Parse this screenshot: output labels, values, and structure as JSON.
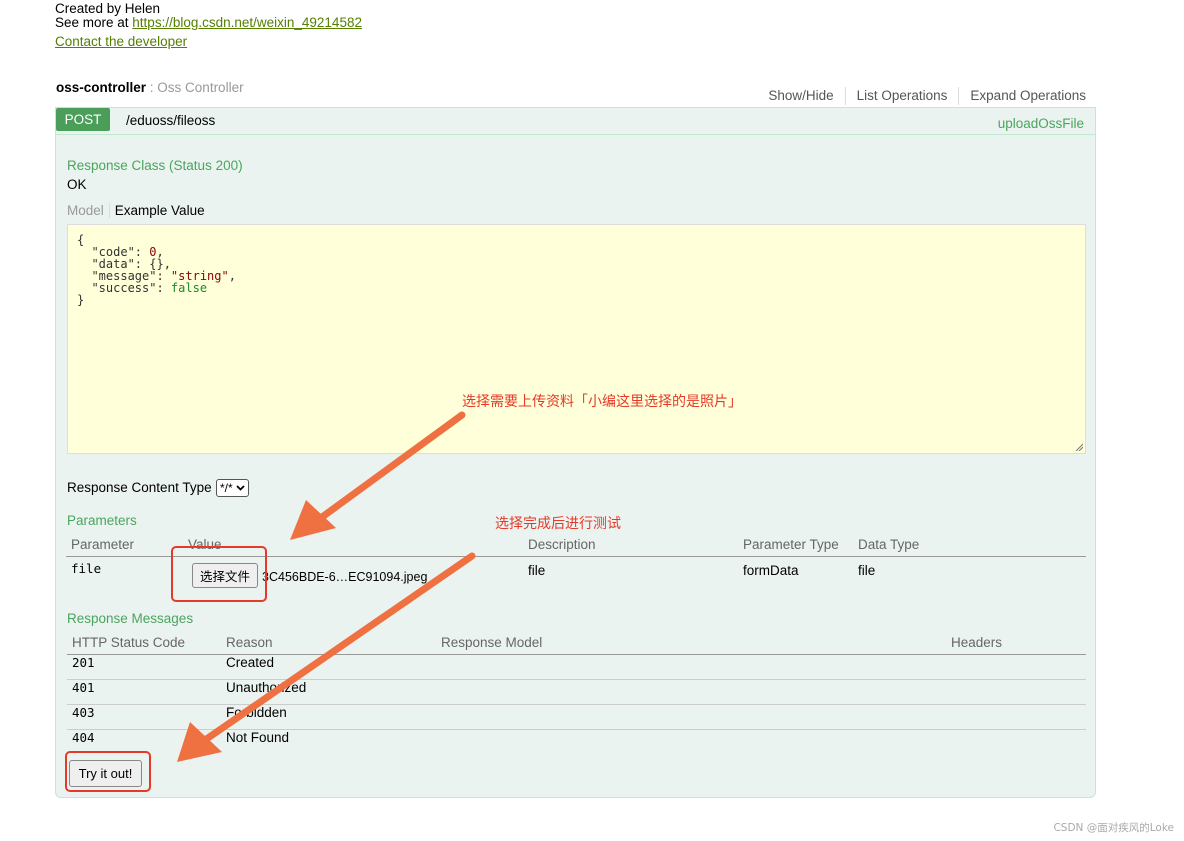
{
  "header": {
    "created_by": "Created by Helen",
    "see_more_prefix": "See more at ",
    "see_more_link": "https://blog.csdn.net/weixin_49214582",
    "contact": "Contact the developer"
  },
  "controller": {
    "name": "oss-controller",
    "separator": " : ",
    "description": "Oss Controller",
    "links": [
      "Show/Hide",
      "List Operations",
      "Expand Operations"
    ]
  },
  "operation": {
    "method": "POST",
    "path": "/eduoss/fileoss",
    "nickname": "uploadOssFile",
    "method_color": "#4a9e5a",
    "response_class_title": "Response Class (Status 200)",
    "response_class_value": "OK",
    "model_tab": "Model",
    "example_tab": "Example Value",
    "example_json": {
      "open": "{",
      "code_key": "  \"code\": ",
      "code_val": "0",
      "data_key": "  \"data\": ",
      "data_val": "{}",
      "message_key": "  \"message\": ",
      "message_val": "\"string\"",
      "success_key": "  \"success\": ",
      "success_val": "false",
      "close": "}"
    },
    "response_content_type_label": "Response Content Type",
    "response_content_type_value": "*/*",
    "parameters_title": "Parameters",
    "parameters_headers": [
      "Parameter",
      "Value",
      "Description",
      "Parameter Type",
      "Data Type"
    ],
    "parameters": [
      {
        "name": "file",
        "choose_button": "选择文件",
        "file_name": "3C456BDE-6…EC91094.jpeg",
        "description": "file",
        "parameter_type": "formData",
        "data_type": "file"
      }
    ],
    "response_messages_title": "Response Messages",
    "response_headers": [
      "HTTP Status Code",
      "Reason",
      "Response Model",
      "Headers"
    ],
    "responses": [
      {
        "code": "201",
        "reason": "Created"
      },
      {
        "code": "401",
        "reason": "Unauthorized"
      },
      {
        "code": "403",
        "reason": "Forbidden"
      },
      {
        "code": "404",
        "reason": "Not Found"
      }
    ],
    "try_button": "Try it out!"
  },
  "annotations": {
    "select_file_note": "选择需要上传资料「小编这里选择的是照片」",
    "test_note": "选择完成后进行测试",
    "color": "#e53a2a",
    "arrow_color": "#ef7040"
  },
  "watermark": "CSDN @面对疾风的Loke"
}
